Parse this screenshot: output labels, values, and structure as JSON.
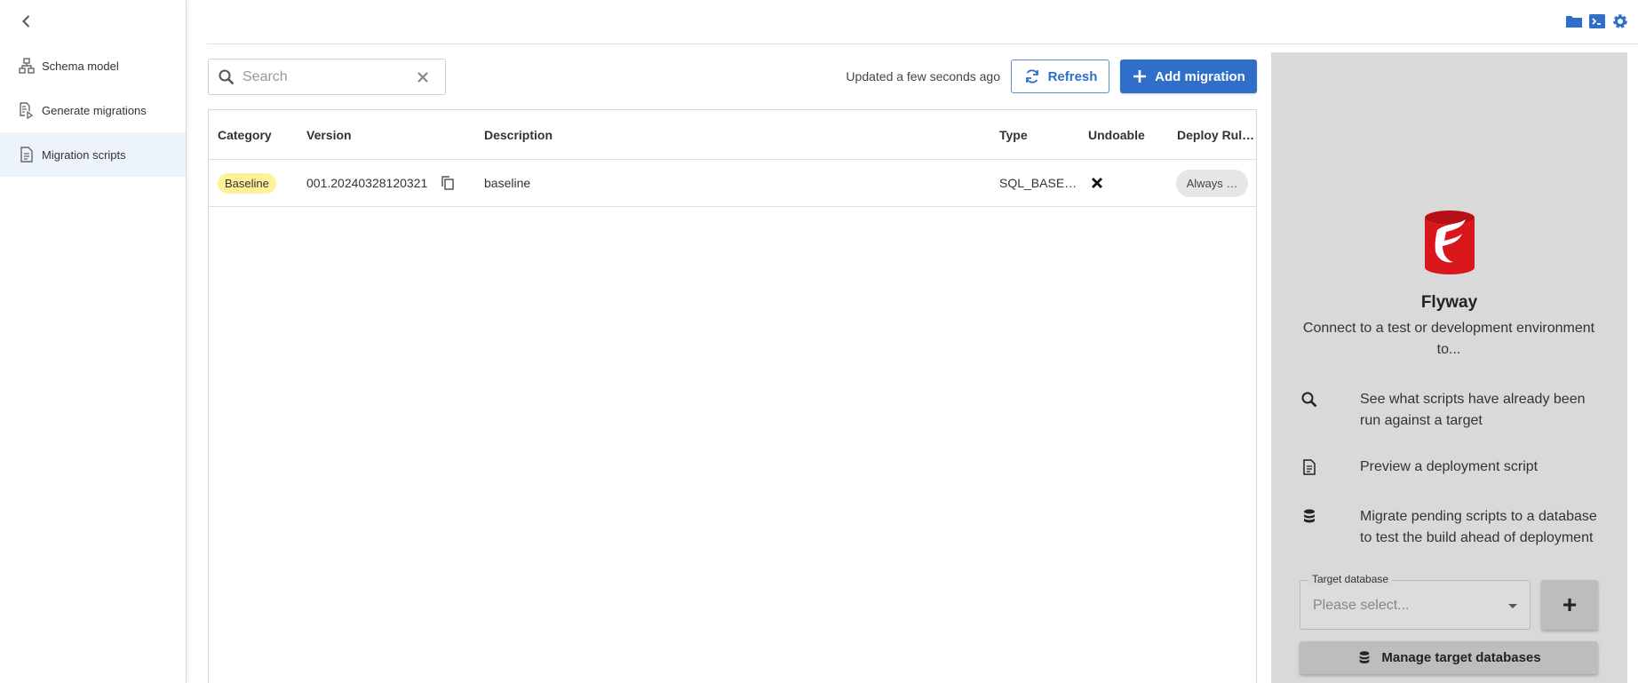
{
  "sidebar": {
    "back_icon": "chevron-left-icon",
    "items": [
      {
        "label": "Schema model",
        "icon": "hierarchy-icon"
      },
      {
        "label": "Generate migrations",
        "icon": "generate-icon"
      },
      {
        "label": "Migration scripts",
        "icon": "document-icon",
        "active": true
      }
    ]
  },
  "topbar": {
    "icons": [
      "folder-icon",
      "terminal-icon",
      "gear-icon"
    ]
  },
  "toolbar": {
    "search_placeholder": "Search",
    "updated_text": "Updated a few seconds ago",
    "refresh_label": "Refresh",
    "add_migration_label": "Add migration"
  },
  "table": {
    "columns": [
      "Category",
      "Version",
      "Description",
      "Type",
      "Undoable",
      "Deploy Rul…"
    ],
    "rows": [
      {
        "category": "Baseline",
        "version": "001.20240328120321",
        "description": "baseline",
        "type": "SQL_BASE…",
        "undoable": "✕",
        "deploy_rule": "Always …"
      }
    ]
  },
  "panel": {
    "title": "Flyway",
    "subtitle": "Connect to a test or development environment to...",
    "features": [
      {
        "icon": "search-icon",
        "text": "See what scripts have already been run against a target"
      },
      {
        "icon": "document-icon",
        "text": "Preview a deployment script"
      },
      {
        "icon": "database-icon",
        "text": "Migrate pending scripts to a database to test the build ahead of deployment"
      }
    ],
    "target_label": "Target database",
    "target_placeholder": "Please select...",
    "add_label": "+",
    "manage_label": "Manage target databases"
  },
  "colors": {
    "accent": "#2f6fca",
    "badge": "#fdf19a",
    "panel_bg": "#d9d9d9",
    "logo_red": "#d8161b"
  }
}
